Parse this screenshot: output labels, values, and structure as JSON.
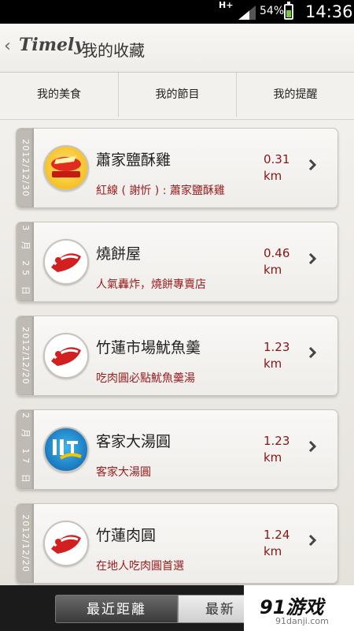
{
  "status_bar": {
    "network": "H+",
    "battery": "54%",
    "time": "14:36"
  },
  "app": {
    "logo": "Timely",
    "title": "我的收藏"
  },
  "tabs": [
    {
      "label": "我的美食"
    },
    {
      "label": "我的節目"
    },
    {
      "label": "我的提醒"
    }
  ],
  "active_tab": 0,
  "favorites": [
    {
      "date": "2012/12/30",
      "name": "蕭家鹽酥雞",
      "description": "紅線 ( 謝忻 ) : 蕭家鹽酥雞",
      "distance": "0.31",
      "unit": "km",
      "thumb": "yellow-badge-icon"
    },
    {
      "date": "3 月 25 日",
      "name": "燒餅屋",
      "description": "人氣轟炸，燒餅專賣店",
      "distance": "0.46",
      "unit": "km",
      "thumb": "show-logo-icon"
    },
    {
      "date": "2012/12/20",
      "name": "竹蓮市場魷魚羹",
      "description": "吃肉圓必點魷魚羹湯",
      "distance": "1.23",
      "unit": "km",
      "thumb": "show-logo-icon"
    },
    {
      "date": "2 月 17 日",
      "name": "客家大湯圓",
      "description": "客家大湯圓",
      "distance": "1.23",
      "unit": "km",
      "thumb": "blue-logo-icon"
    },
    {
      "date": "2012/12/20",
      "name": "竹蓮肉圓",
      "description": "在地人吃肉圓首選",
      "distance": "1.24",
      "unit": "km",
      "thumb": "show-logo-icon"
    }
  ],
  "sort_buttons": [
    {
      "label": "最近距離"
    },
    {
      "label": "最新"
    }
  ],
  "watermark": {
    "text": "91游戏",
    "url": "91danji.com"
  },
  "colors": {
    "accent": "#1796c8",
    "distance": "#8b1414",
    "description": "#9a1b1b"
  }
}
